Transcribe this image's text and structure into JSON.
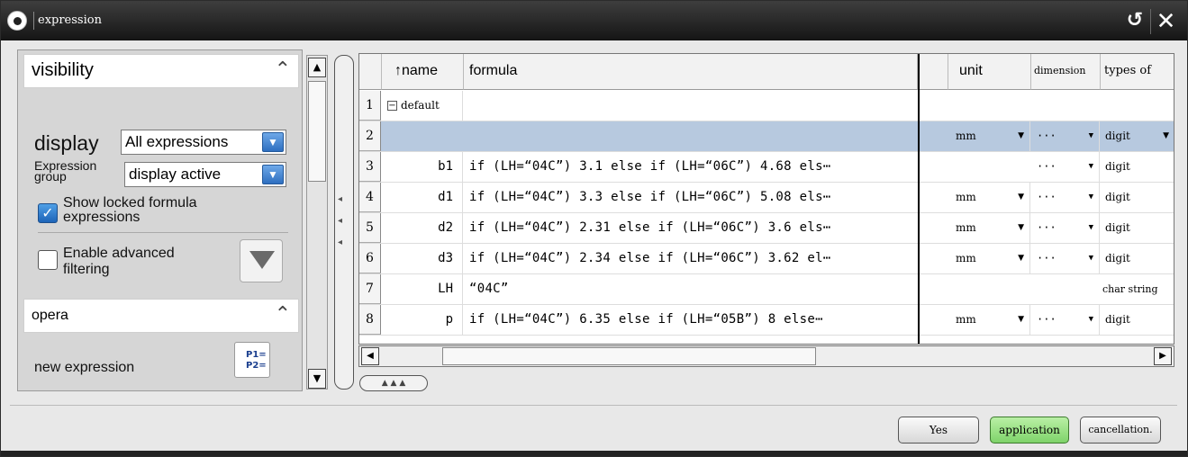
{
  "window": {
    "title": "expression"
  },
  "left": {
    "visibility": {
      "header": "visibility"
    },
    "display": {
      "label": "display",
      "value": "All expressions"
    },
    "group": {
      "label_line1": "Expression",
      "label_line2": "group",
      "value": "display active"
    },
    "show_locked": {
      "line1": "Show locked formula",
      "line2": "expressions",
      "checked": true
    },
    "advanced": {
      "line1": "Enable advanced",
      "line2": "filtering",
      "checked": false
    },
    "opera": {
      "header": "opera"
    },
    "new_expression": {
      "label": "new expression",
      "icon_text1": "P1=",
      "icon_text2": "P2="
    }
  },
  "grid": {
    "headers": {
      "name": "↑name",
      "formula": "formula",
      "unit": "unit",
      "dimension": "dimension",
      "type": "types of"
    },
    "rows": [
      {
        "num": "1",
        "name": "default",
        "formula": "",
        "unit": "",
        "dimension": "",
        "type": ""
      },
      {
        "num": "2",
        "name": "",
        "formula": "",
        "unit": "mm",
        "dimension": "···",
        "type": "digit"
      },
      {
        "num": "3",
        "name": "b1",
        "formula": "if (LH=“04C”) 3.1 else if (LH=“06C”) 4.68 els⋯",
        "unit": "",
        "dimension": "···",
        "type": "digit"
      },
      {
        "num": "4",
        "name": "d1",
        "formula": "if (LH=“04C”) 3.3 else if (LH=“06C”) 5.08 els⋯",
        "unit": "mm",
        "dimension": "···",
        "type": "digit"
      },
      {
        "num": "5",
        "name": "d2",
        "formula": "if (LH=“04C”) 2.31 else if (LH=“06C”) 3.6 els⋯",
        "unit": "mm",
        "dimension": "···",
        "type": "digit"
      },
      {
        "num": "6",
        "name": "d3",
        "formula": "if (LH=“04C”) 2.34 else if (LH=“06C”) 3.62 el⋯",
        "unit": "mm",
        "dimension": "···",
        "type": "digit"
      },
      {
        "num": "7",
        "name": "LH",
        "formula": "“04C”",
        "unit": "",
        "dimension": "",
        "type": "char string"
      },
      {
        "num": "8",
        "name": "p",
        "formula": "if (LH=“04C”) 6.35  else if (LH=“05B”) 8 else⋯",
        "unit": "mm",
        "dimension": "···",
        "type": "digit"
      }
    ]
  },
  "footer": {
    "yes": "Yes",
    "application": "application",
    "cancel": "cancellation."
  }
}
